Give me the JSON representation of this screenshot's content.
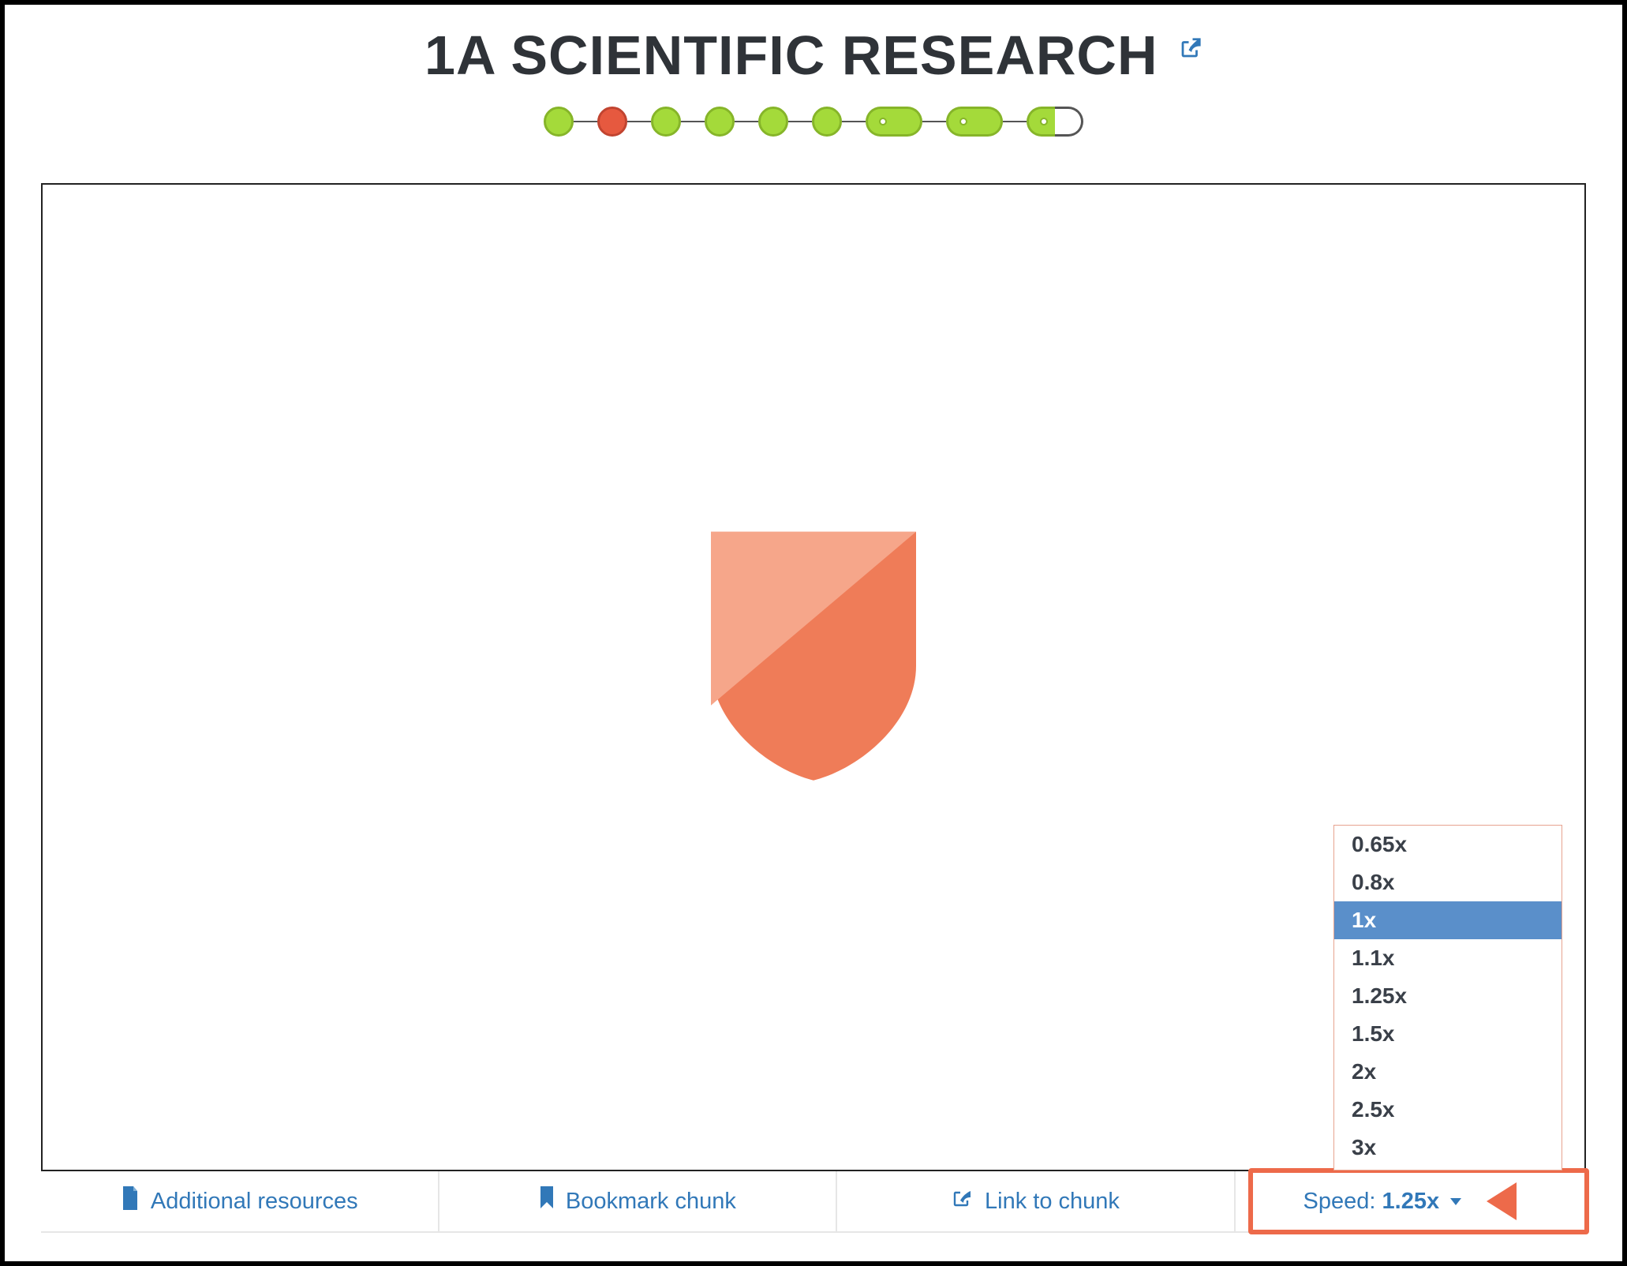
{
  "title": "1A SCIENTIFIC RESEARCH",
  "progress_nodes": [
    {
      "type": "dot",
      "state": "green"
    },
    {
      "type": "dot",
      "state": "red"
    },
    {
      "type": "dot",
      "state": "green"
    },
    {
      "type": "dot",
      "state": "green"
    },
    {
      "type": "dot",
      "state": "green"
    },
    {
      "type": "dot",
      "state": "green"
    },
    {
      "type": "capsule",
      "left": "green-dot",
      "right": "green"
    },
    {
      "type": "capsule",
      "left": "green-dot",
      "right": "green"
    },
    {
      "type": "capsule",
      "left": "green-dot",
      "right": "white"
    }
  ],
  "toolbar": {
    "additional_resources": "Additional resources",
    "bookmark_chunk": "Bookmark chunk",
    "link_to_chunk": "Link to chunk",
    "speed_label": "Speed:",
    "speed_value": "1.25x"
  },
  "speed_menu": {
    "options": [
      "0.65x",
      "0.8x",
      "1x",
      "1.1x",
      "1.25x",
      "1.5x",
      "2x",
      "2.5x",
      "3x"
    ],
    "highlighted": "1x"
  },
  "colors": {
    "link": "#3178b8",
    "accent": "#ed6a4a",
    "green_fill": "#a4da3a",
    "green_border": "#86b529",
    "red_fill": "#e6593f",
    "menu_highlight": "#5a8fca"
  }
}
